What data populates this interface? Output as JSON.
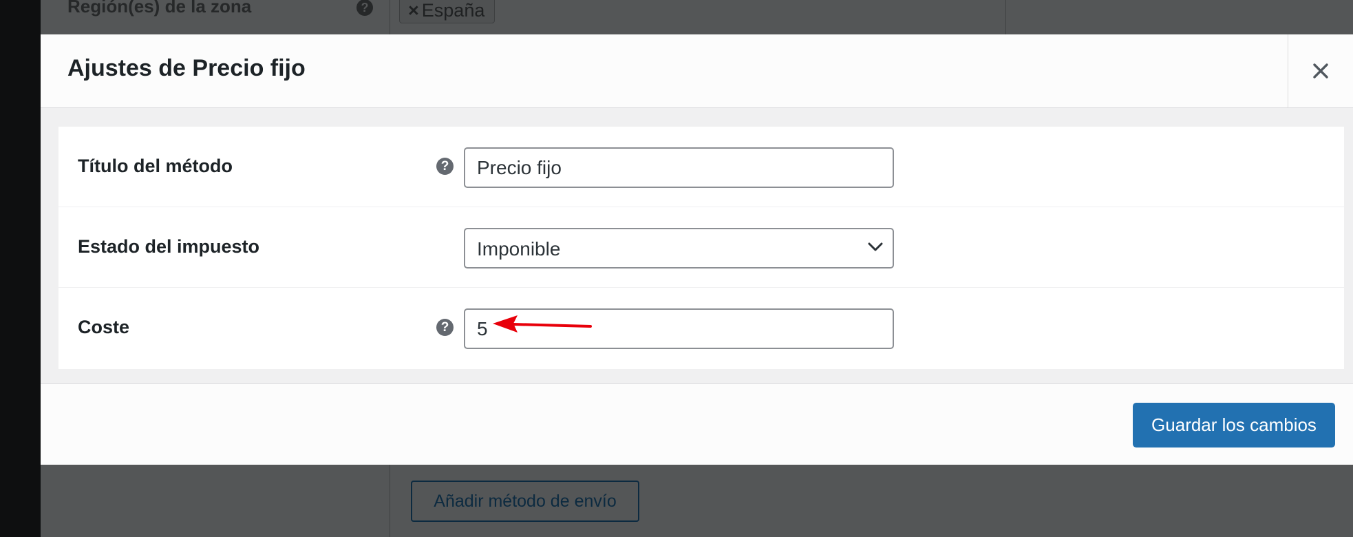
{
  "background": {
    "region_label": "Región(es) de la zona",
    "help_glyph": "?",
    "region_chip": {
      "remove_glyph": "×",
      "label": "España"
    },
    "add_method_button": "Añadir método de envío"
  },
  "modal": {
    "title": "Ajustes de Precio fijo",
    "close_icon": "close-icon",
    "fields": [
      {
        "label": "Título del método",
        "type": "text",
        "value": "Precio fijo",
        "has_help": true
      },
      {
        "label": "Estado del impuesto",
        "type": "select",
        "value": "Imponible",
        "has_help": false
      },
      {
        "label": "Coste",
        "type": "text",
        "value": "5",
        "has_help": true
      }
    ],
    "help_glyph": "?",
    "save_button": "Guardar los cambios"
  },
  "colors": {
    "accent": "#2271b1",
    "annotation_arrow": "#e8000a",
    "overlay_background": "#545657"
  }
}
